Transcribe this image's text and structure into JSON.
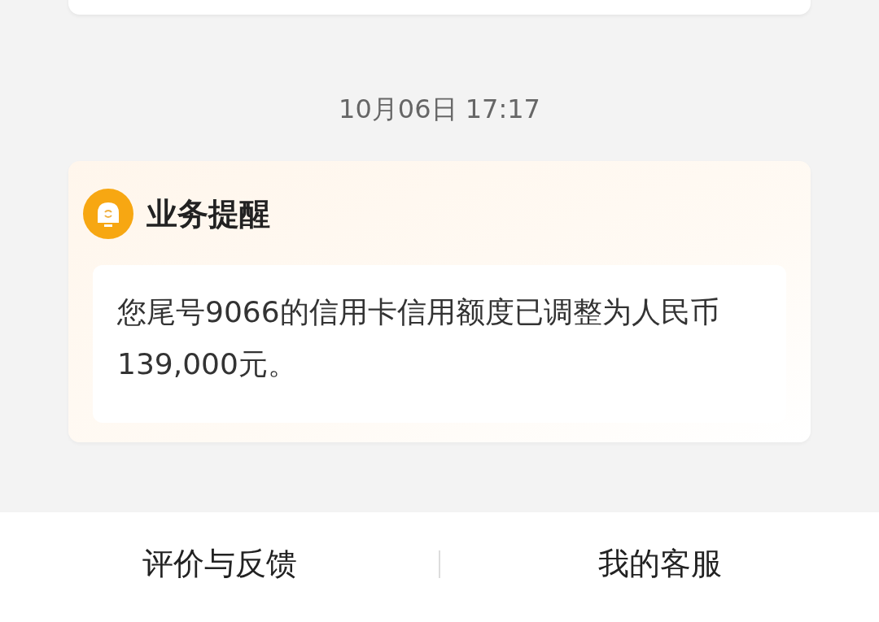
{
  "timestamp": "10月06日 17:17",
  "message": {
    "title": "业务提醒",
    "body": "您尾号9066的信用卡信用额度已调整为人民币139,000元。"
  },
  "footer": {
    "buttons": [
      "评价与反馈",
      "我的客服"
    ]
  }
}
